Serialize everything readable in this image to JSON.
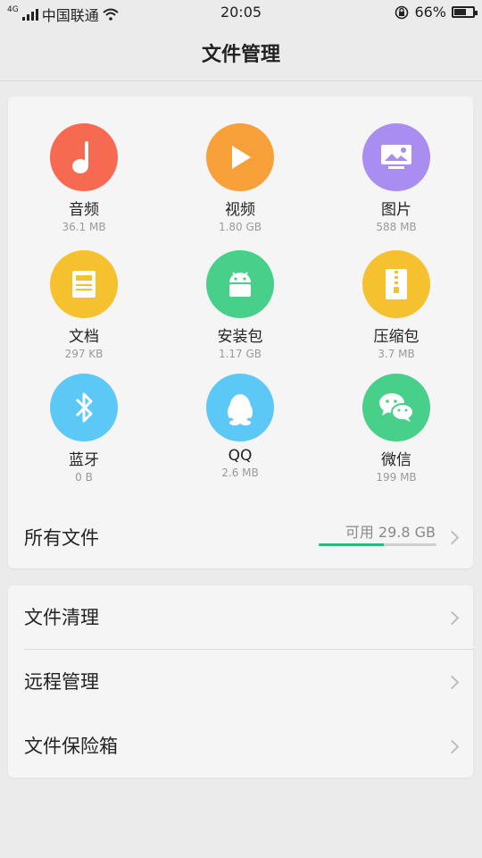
{
  "status": {
    "network": "4G",
    "carrier": "中国联通",
    "time": "20:05",
    "battery_text": "66%",
    "battery_level": 0.66
  },
  "header": {
    "title": "文件管理"
  },
  "categories": [
    {
      "label": "音频",
      "size": "36.1 MB",
      "icon": "music-note-icon",
      "color": "#f66a52"
    },
    {
      "label": "视频",
      "size": "1.80 GB",
      "icon": "play-icon",
      "color": "#f8a13a"
    },
    {
      "label": "图片",
      "size": "588 MB",
      "icon": "image-icon",
      "color": "#a98df0"
    },
    {
      "label": "文档",
      "size": "297 KB",
      "icon": "document-icon",
      "color": "#f6c12f"
    },
    {
      "label": "安装包",
      "size": "1.17 GB",
      "icon": "android-icon",
      "color": "#48d08a"
    },
    {
      "label": "压缩包",
      "size": "3.7 MB",
      "icon": "zip-icon",
      "color": "#f6c12f"
    },
    {
      "label": "蓝牙",
      "size": "0 B",
      "icon": "bluetooth-icon",
      "color": "#5cc8f5"
    },
    {
      "label": "QQ",
      "size": "2.6 MB",
      "icon": "qq-penguin-icon",
      "color": "#5cc8f5"
    },
    {
      "label": "微信",
      "size": "199 MB",
      "icon": "wechat-icon",
      "color": "#48d08a"
    }
  ],
  "all_files": {
    "label": "所有文件",
    "free_text": "可用 29.8 GB",
    "used_fraction": 0.55
  },
  "menu": [
    {
      "label": "文件清理"
    },
    {
      "label": "远程管理"
    },
    {
      "label": "文件保险箱"
    }
  ]
}
